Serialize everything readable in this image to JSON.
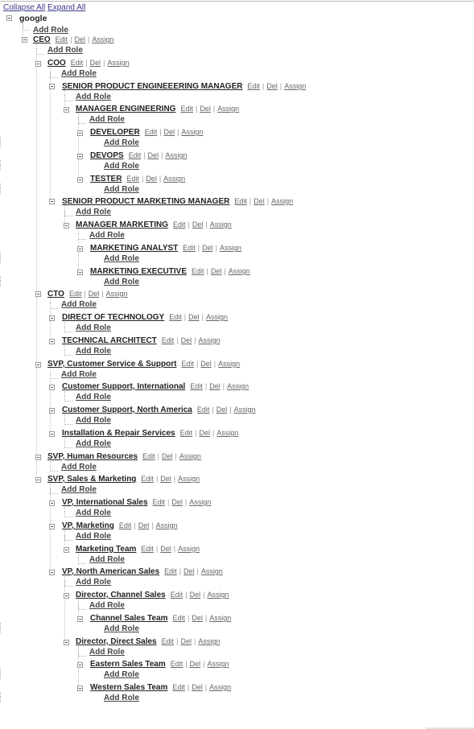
{
  "toolbar": {
    "collapse_label": "Collapse All",
    "expand_label": "Expand All"
  },
  "labels": {
    "add_role": "Add Role",
    "edit": "Edit",
    "del": "Del",
    "assign": "Assign"
  },
  "root": {
    "name": "google"
  },
  "nodes": [
    {
      "name": "CEO",
      "level": 1,
      "toggle": [
        27,
        46
      ],
      "text": [
        41,
        47
      ],
      "add": [
        59,
        62
      ]
    },
    {
      "name": "COO",
      "level": 2,
      "toggle": [
        44,
        76
      ],
      "text": [
        59,
        76
      ],
      "add": [
        76,
        91
      ]
    },
    {
      "name": "SENIOR PRODUCT ENGINEEERING MANAGER",
      "level": 3,
      "toggle": [
        61,
        104
      ],
      "text": [
        77,
        105
      ],
      "add": [
        94,
        120
      ]
    },
    {
      "name": "MANAGER ENGINEERING",
      "level": 4,
      "toggle": [
        79,
        133
      ],
      "text": [
        94,
        133
      ],
      "add": [
        111,
        148
      ]
    },
    {
      "name": "DEVELOPER",
      "level": 5,
      "toggle": [
        96,
        162
      ],
      "text": [
        112,
        162
      ],
      "add": [
        129,
        177
      ]
    },
    {
      "name": "DEVOPS",
      "level": 5,
      "toggle": [
        96,
        191
      ],
      "text": [
        112,
        191
      ],
      "add": [
        129,
        206
      ]
    },
    {
      "name": "TESTER",
      "level": 5,
      "toggle": [
        96,
        220
      ],
      "text": [
        112,
        220
      ],
      "add": [
        129,
        235
      ]
    },
    {
      "name": "SENIOR PRODUCT MARKETING MANAGER",
      "level": 3,
      "toggle": [
        61,
        247
      ],
      "text": [
        77,
        248
      ],
      "add": [
        94,
        263
      ]
    },
    {
      "name": "MANAGER MARKETING",
      "level": 4,
      "toggle": [
        79,
        277
      ],
      "text": [
        94,
        277
      ],
      "add": [
        111,
        292
      ]
    },
    {
      "name": "MARKETING ANALYST",
      "level": 5,
      "toggle": [
        96,
        306
      ],
      "text": [
        112,
        306
      ],
      "add": [
        129,
        321
      ]
    },
    {
      "name": "MARKETING EXECUTIVE",
      "level": 5,
      "toggle": [
        96,
        335
      ],
      "text": [
        112,
        335
      ],
      "add": [
        129,
        350
      ]
    },
    {
      "name": "CTO",
      "level": 2,
      "toggle": [
        44,
        362
      ],
      "text": [
        59,
        363
      ],
      "add": [
        76,
        378
      ]
    },
    {
      "name": "DIRECT OF TECHNOLOGY",
      "level": 3,
      "toggle": [
        61,
        392
      ],
      "text": [
        77,
        392
      ],
      "add": [
        94,
        407
      ]
    },
    {
      "name": "TECHNICAL ARCHITECT",
      "level": 3,
      "toggle": [
        61,
        421
      ],
      "text": [
        77,
        421
      ],
      "add": [
        94,
        436
      ]
    },
    {
      "name": "SVP, Customer Service & Support",
      "level": 2,
      "toggle": [
        44,
        450
      ],
      "text": [
        59,
        450
      ],
      "add": [
        76,
        465
      ]
    },
    {
      "name": "Customer Support, International",
      "level": 3,
      "toggle": [
        61,
        478
      ],
      "text": [
        77,
        478
      ],
      "add": [
        94,
        493
      ]
    },
    {
      "name": "Customer Support, North America",
      "level": 3,
      "toggle": [
        61,
        507
      ],
      "text": [
        77,
        507
      ],
      "add": [
        94,
        522
      ]
    },
    {
      "name": "Installation & Repair Services",
      "level": 3,
      "toggle": [
        61,
        536
      ],
      "text": [
        77,
        536
      ],
      "add": [
        94,
        551
      ]
    },
    {
      "name": "SVP, Human Resources",
      "level": 2,
      "toggle": [
        44,
        565
      ],
      "text": [
        59,
        565
      ],
      "add": [
        76,
        580
      ]
    },
    {
      "name": "SVP, Sales & Marketing",
      "level": 2,
      "toggle": [
        44,
        593
      ],
      "text": [
        59,
        593
      ],
      "add": [
        76,
        608
      ]
    },
    {
      "name": "VP, International Sales",
      "level": 3,
      "toggle": [
        61,
        622
      ],
      "text": [
        77,
        622
      ],
      "add": [
        94,
        637
      ]
    },
    {
      "name": "VP, Marketing",
      "level": 3,
      "toggle": [
        61,
        651
      ],
      "text": [
        77,
        651
      ],
      "add": [
        94,
        666
      ]
    },
    {
      "name": "Marketing Team",
      "level": 4,
      "toggle": [
        79,
        680
      ],
      "text": [
        94,
        680
      ],
      "add": [
        111,
        695
      ]
    },
    {
      "name": "VP, North American Sales",
      "level": 3,
      "toggle": [
        61,
        708
      ],
      "text": [
        77,
        708
      ],
      "add": [
        94,
        723
      ]
    },
    {
      "name": "Director, Channel Sales",
      "level": 4,
      "toggle": [
        79,
        737
      ],
      "text": [
        94,
        737
      ],
      "add": [
        111,
        752
      ]
    },
    {
      "name": "Channel Sales Team",
      "level": 5,
      "toggle": [
        96,
        766
      ],
      "text": [
        112,
        766
      ],
      "add": [
        129,
        781
      ]
    },
    {
      "name": "Director, Direct Sales",
      "level": 4,
      "toggle": [
        79,
        795
      ],
      "text": [
        94,
        795
      ],
      "add": [
        111,
        810
      ]
    },
    {
      "name": "Eastern Sales Team",
      "level": 5,
      "toggle": [
        96,
        823
      ],
      "text": [
        112,
        823
      ],
      "add": [
        129,
        838
      ]
    },
    {
      "name": "Western Sales Team",
      "level": 5,
      "toggle": [
        96,
        852
      ],
      "text": [
        112,
        852
      ],
      "add": [
        129,
        867
      ]
    }
  ]
}
